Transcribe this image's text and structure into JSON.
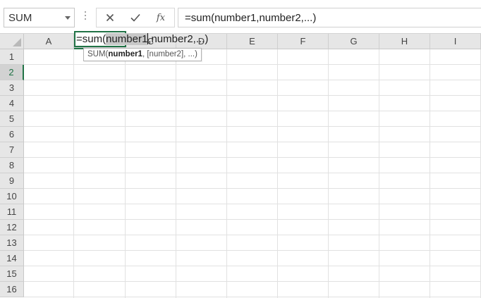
{
  "formula_bar": {
    "name_box": "SUM",
    "cancel_icon": "close-icon",
    "enter_icon": "checkmark-icon",
    "fx_label": "fx",
    "formula": "=sum(number1,number2,...)"
  },
  "grid": {
    "columns": [
      "A",
      "B",
      "C",
      "D",
      "E",
      "F",
      "G",
      "H",
      "I"
    ],
    "rows": [
      "1",
      "2",
      "3",
      "4",
      "5",
      "6",
      "7",
      "8",
      "9",
      "10",
      "11",
      "12",
      "13",
      "14",
      "15",
      "16"
    ],
    "selected_column": "B",
    "selected_row": "2"
  },
  "editor": {
    "prefix": "=sum(",
    "highlighted": "number1",
    "suffix": ",number2,...)"
  },
  "tooltip": {
    "func": "SUM(",
    "arg_bold": "number1",
    "rest": ", [number2], ...)"
  },
  "colors": {
    "accent": "#217346",
    "header_bg": "#e6e6e6",
    "selected_header_bg": "#d2d2d2",
    "gridline": "#e1e1e1"
  }
}
